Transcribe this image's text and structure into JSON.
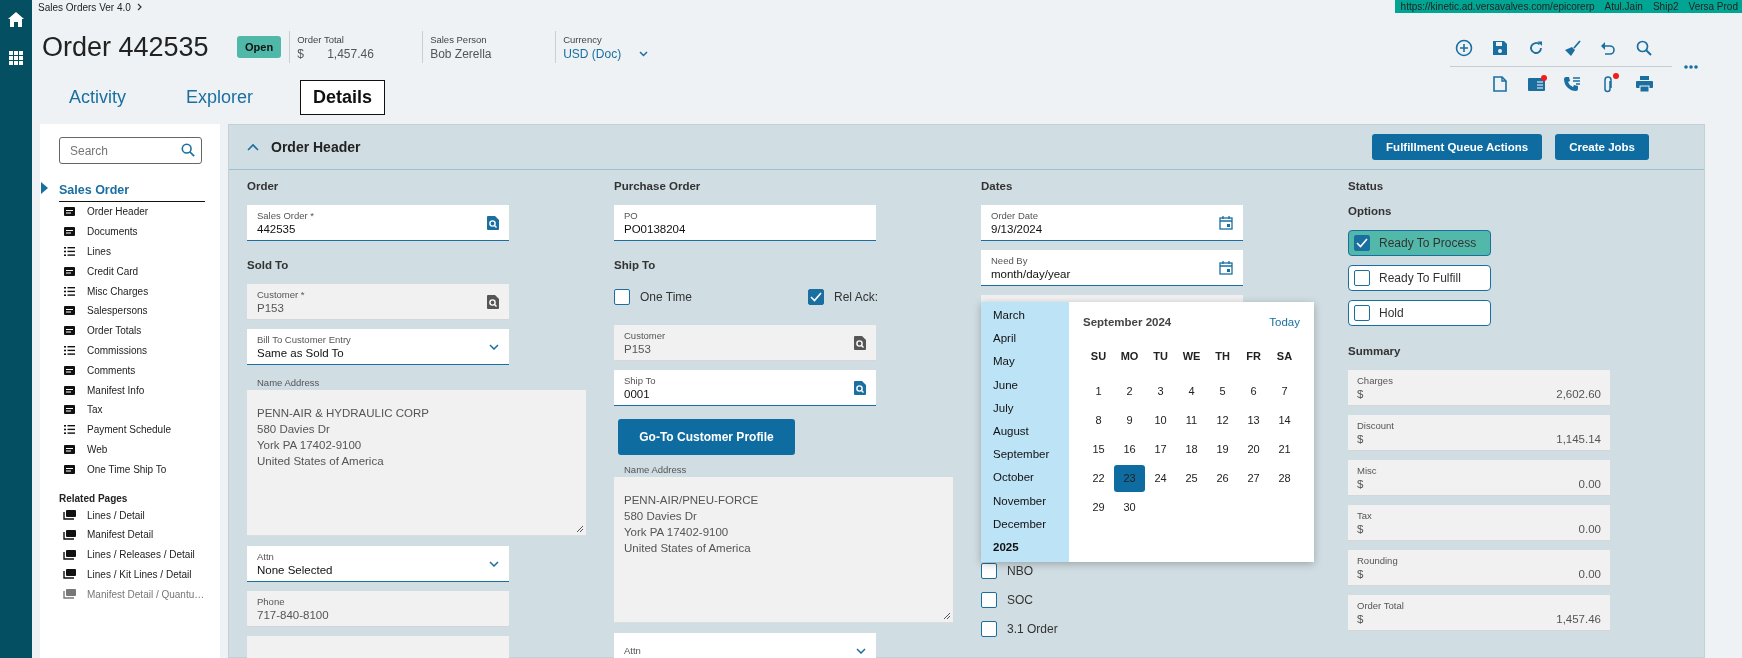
{
  "breadcrumb": "Sales Orders Ver 4.0",
  "session": [
    "https://kinetic.ad.versavalves.com/epicorerp",
    "Atul.Jain",
    "Ship2",
    "Versa Prod"
  ],
  "header": {
    "title": "Order 442535",
    "status": "Open",
    "meta": [
      {
        "label": "Order Total",
        "symbol": "$",
        "value": "1,457.46"
      },
      {
        "label": "Sales Person",
        "value": "Bob Zerella"
      },
      {
        "label": "Currency",
        "value": "USD (Doc)",
        "dropdown": true
      }
    ]
  },
  "tabs": [
    {
      "label": "Activity",
      "selected": false
    },
    {
      "label": "Explorer",
      "selected": false
    },
    {
      "label": "Details",
      "selected": true
    }
  ],
  "toolbar": {
    "primary": [
      {
        "kind": "add"
      },
      {
        "kind": "save"
      },
      {
        "kind": "refresh"
      },
      {
        "kind": "clear"
      },
      {
        "kind": "undo"
      },
      {
        "kind": "search"
      }
    ],
    "secondary": [
      {
        "kind": "document",
        "alert": false
      },
      {
        "kind": "card",
        "alert": true
      },
      {
        "kind": "calls",
        "alert": false
      },
      {
        "kind": "attachment",
        "alert": true
      },
      {
        "kind": "print",
        "alert": false
      }
    ]
  },
  "sidebar": {
    "search_placeholder": "Search",
    "section": {
      "label": "Sales Order",
      "selected": true
    },
    "items": [
      {
        "label": "Order Header",
        "kind": "card"
      },
      {
        "label": "Documents",
        "kind": "card"
      },
      {
        "label": "Lines",
        "kind": "list"
      },
      {
        "label": "Credit Card",
        "kind": "card"
      },
      {
        "label": "Misc Charges",
        "kind": "list"
      },
      {
        "label": "Salespersons",
        "kind": "card"
      },
      {
        "label": "Order Totals",
        "kind": "card"
      },
      {
        "label": "Commissions",
        "kind": "list"
      },
      {
        "label": "Comments",
        "kind": "card"
      },
      {
        "label": "Manifest Info",
        "kind": "card"
      },
      {
        "label": "Tax",
        "kind": "card"
      },
      {
        "label": "Payment Schedule",
        "kind": "list"
      },
      {
        "label": "Web",
        "kind": "card"
      },
      {
        "label": "One Time Ship To",
        "kind": "card"
      }
    ],
    "related_title": "Related Pages",
    "related": [
      {
        "label": "Lines / Detail",
        "disabled": false
      },
      {
        "label": "Manifest Detail",
        "disabled": false
      },
      {
        "label": "Lines / Releases / Detail",
        "disabled": false
      },
      {
        "label": "Lines / Kit Lines / Detail",
        "disabled": false
      },
      {
        "label": "Manifest Detail / Quantu…",
        "disabled": true
      }
    ]
  },
  "panel": {
    "title": "Order Header",
    "expanded": true,
    "actions": [
      "Fulfillment Queue Actions",
      "Create Jobs"
    ],
    "columns": [
      {
        "blocks": [
          {
            "kind": "heading",
            "text": "Order"
          },
          {
            "kind": "field",
            "label": "Sales Order *",
            "value": "442535",
            "readonly": false,
            "lookup": true
          },
          {
            "kind": "heading",
            "text": "Sold To"
          },
          {
            "kind": "field",
            "label": "Customer *",
            "value": "P153",
            "readonly": true,
            "lookup": true
          },
          {
            "kind": "select",
            "label": "Bill To Customer Entry",
            "value": "Same as Sold To"
          },
          {
            "kind": "textarea",
            "label": "Name Address",
            "lines": [
              "PENN-AIR & HYDRAULIC CORP",
              "580 Davies Dr",
              "York PA 17402-9100",
              "United States of America"
            ]
          },
          {
            "kind": "select",
            "label": "Attn",
            "value": "None Selected"
          },
          {
            "kind": "field",
            "label": "Phone",
            "value": "717-840-8100",
            "readonly": true
          },
          {
            "kind": "field",
            "readonly": true
          }
        ]
      },
      {
        "blocks": [
          {
            "kind": "heading",
            "text": "Purchase Order"
          },
          {
            "kind": "field",
            "label": "PO",
            "value": "PO0138204",
            "readonly": false
          },
          {
            "kind": "heading",
            "text": "Ship To"
          },
          {
            "kind": "checks",
            "items": [
              {
                "label": "One Time",
                "checked": false
              },
              {
                "label": "Rel Ack:",
                "checked": true
              }
            ]
          },
          {
            "kind": "field",
            "label": "Customer",
            "value": "P153",
            "readonly": true,
            "lookup": true
          },
          {
            "kind": "field",
            "label": "Ship To",
            "value": "0001",
            "readonly": false,
            "lookup": true
          },
          {
            "kind": "button",
            "text": "Go-To Customer Profile"
          },
          {
            "kind": "textarea",
            "label": "Name Address",
            "lines": [
              "PENN-AIR/PNEU-FORCE",
              "580 Davies Dr",
              "York PA 17402-9100",
              "United States of America"
            ]
          },
          {
            "kind": "select",
            "label": "Attn"
          }
        ]
      },
      {
        "blocks": [
          {
            "kind": "heading",
            "text": "Dates"
          },
          {
            "kind": "field",
            "label": "Order Date",
            "value": "9/13/2024",
            "readonly": false,
            "calendar": true
          },
          {
            "kind": "field",
            "label": "Need By",
            "placeholder": "month/day/year",
            "readonly": false,
            "calendar": true
          },
          {
            "kind": "field",
            "readonly": true
          },
          {
            "kind": "checklist",
            "items": [
              {
                "label": "NBO",
                "checked": false
              },
              {
                "label": "SOC",
                "checked": false
              },
              {
                "label": "3.1 Order",
                "checked": false
              }
            ]
          }
        ]
      },
      {
        "blocks": [
          {
            "kind": "heading",
            "text": "Status"
          },
          {
            "kind": "heading",
            "text": "Options"
          },
          {
            "kind": "options",
            "items": [
              {
                "label": "Ready To Process",
                "checked": true
              },
              {
                "label": "Ready To Fulfill",
                "checked": false
              },
              {
                "label": "Hold",
                "checked": false
              }
            ]
          },
          {
            "kind": "heading",
            "text": "Summary"
          },
          {
            "kind": "amount",
            "label": "Charges",
            "symbol": "$",
            "value": "2,602.60"
          },
          {
            "kind": "amount",
            "label": "Discount",
            "symbol": "$",
            "value": "1,145.14"
          },
          {
            "kind": "amount",
            "label": "Misc",
            "symbol": "$",
            "value": "0.00"
          },
          {
            "kind": "amount",
            "label": "Tax",
            "symbol": "$",
            "value": "0.00"
          },
          {
            "kind": "amount",
            "label": "Rounding",
            "symbol": "$",
            "value": "0.00"
          },
          {
            "kind": "amount",
            "label": "Order Total",
            "symbol": "$",
            "value": "1,457.46"
          }
        ]
      }
    ]
  },
  "calendar": {
    "months": [
      "March",
      "April",
      "May",
      "June",
      "July",
      "August",
      "September",
      "October",
      "November",
      "December"
    ],
    "year": "2025",
    "title": "September 2024",
    "today": "Today",
    "weekdays": [
      "SU",
      "MO",
      "TU",
      "WE",
      "TH",
      "FR",
      "SA"
    ],
    "weeks": [
      [
        {
          "day": "1",
          "selected": false
        },
        {
          "day": "2",
          "selected": false
        },
        {
          "day": "3",
          "selected": false
        },
        {
          "day": "4",
          "selected": false
        },
        {
          "day": "5",
          "selected": false
        },
        {
          "day": "6",
          "selected": false
        },
        {
          "day": "7",
          "selected": false
        }
      ],
      [
        {
          "day": "8",
          "selected": false
        },
        {
          "day": "9",
          "selected": false
        },
        {
          "day": "10",
          "selected": false
        },
        {
          "day": "11",
          "selected": false
        },
        {
          "day": "12",
          "selected": false
        },
        {
          "day": "13",
          "selected": false
        },
        {
          "day": "14",
          "selected": false
        }
      ],
      [
        {
          "day": "15",
          "selected": false
        },
        {
          "day": "16",
          "selected": false
        },
        {
          "day": "17",
          "selected": false
        },
        {
          "day": "18",
          "selected": false
        },
        {
          "day": "19",
          "selected": false
        },
        {
          "day": "20",
          "selected": false
        },
        {
          "day": "21",
          "selected": false
        }
      ],
      [
        {
          "day": "22",
          "selected": false
        },
        {
          "day": "23",
          "selected": true
        },
        {
          "day": "24",
          "selected": false
        },
        {
          "day": "25",
          "selected": false
        },
        {
          "day": "26",
          "selected": false
        },
        {
          "day": "27",
          "selected": false
        },
        {
          "day": "28",
          "selected": false
        }
      ],
      [
        {
          "day": "29",
          "selected": false
        },
        {
          "day": "30",
          "selected": false
        }
      ]
    ]
  }
}
